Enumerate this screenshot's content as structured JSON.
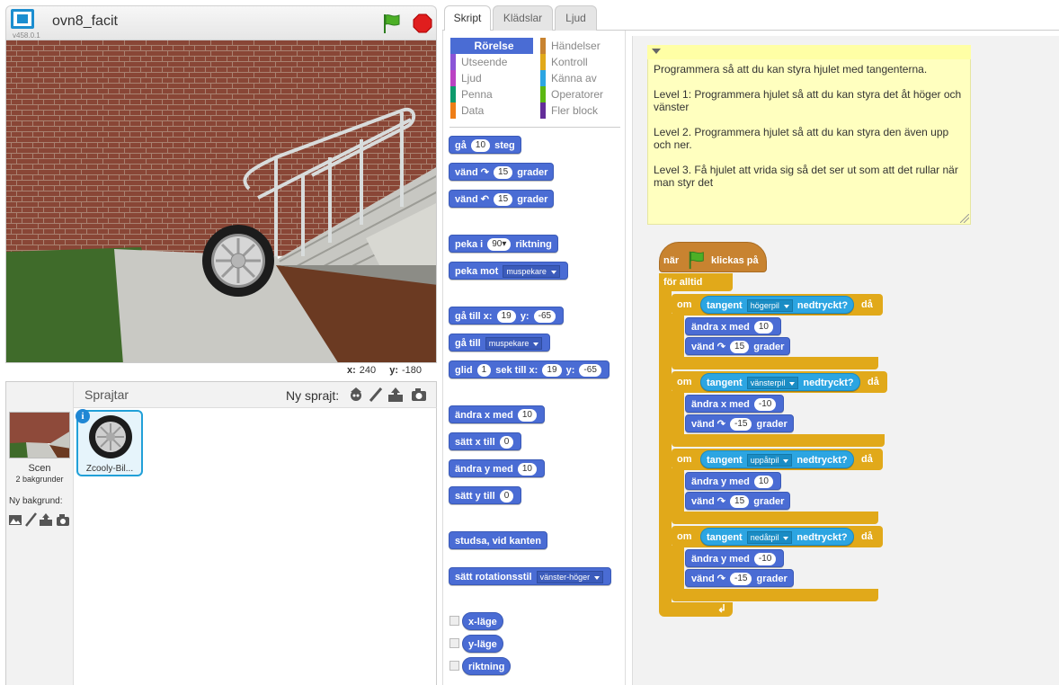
{
  "stage": {
    "title": "ovn8_facit",
    "version": "v458.0.1",
    "x_label": "x:",
    "x_value": "240",
    "y_label": "y:",
    "y_value": "-180"
  },
  "sprites": {
    "title": "Sprajtar",
    "new_sprite": "Ny sprajt:",
    "scene_label": "Scen",
    "scene_backdrops": "2 bakgrunder",
    "new_backdrop": "Ny bakgrund:",
    "sprite_name": "Zcooly-Bil..."
  },
  "tabs": [
    "Skript",
    "Klädslar",
    "Ljud"
  ],
  "categories": {
    "left": [
      "Rörelse",
      "Utseende",
      "Ljud",
      "Penna",
      "Data"
    ],
    "right": [
      "Händelser",
      "Kontroll",
      "Känna av",
      "Operatorer",
      "Fler block"
    ],
    "colors_left": [
      "#4a6cd4",
      "#8a55d7",
      "#bb42c3",
      "#0e9a6c",
      "#ee7d16"
    ],
    "colors_right": [
      "#c88330",
      "#e1a91a",
      "#2ca5e2",
      "#5cb712",
      "#632d99"
    ]
  },
  "palette": {
    "move": [
      "gå",
      "10",
      "steg"
    ],
    "turn_right": [
      "vänd",
      "15",
      "grader"
    ],
    "turn_left": [
      "vänd",
      "15",
      "grader"
    ],
    "point_dir": [
      "peka i",
      "90▾",
      "riktning"
    ],
    "point_towards": [
      "peka mot",
      "muspekare"
    ],
    "goto_xy": [
      "gå till x:",
      "19",
      "y:",
      "-65"
    ],
    "goto": [
      "gå till",
      "muspekare"
    ],
    "glide": [
      "glid",
      "1",
      "sek till x:",
      "19",
      "y:",
      "-65"
    ],
    "change_x": [
      "ändra x med",
      "10"
    ],
    "set_x": [
      "sätt x till",
      "0"
    ],
    "change_y": [
      "ändra y med",
      "10"
    ],
    "set_y": [
      "sätt y till",
      "0"
    ],
    "bounce": "studsa, vid kanten",
    "rotation_style": [
      "sätt rotationsstil",
      "vänster-höger"
    ],
    "reporters": [
      "x-läge",
      "y-läge",
      "riktning"
    ]
  },
  "comment": [
    "Programmera så att du kan styra hjulet med tangenterna.",
    "Level 1: Programmera hjulet så att du kan styra det åt höger och vänster",
    "Level 2. Programmera hjulet så att du kan styra den även upp och ner.",
    "Level 3. Få hjulet att vrida sig så det ser ut som att det rullar när man styr det"
  ],
  "script": {
    "hat_when": "när",
    "hat_clicked": "klickas på",
    "forever": "för alltid",
    "if": "om",
    "then": "då",
    "key": "tangent",
    "pressed": "nedtryckt?",
    "change_x": "ändra x med",
    "change_y": "ändra y med",
    "turn": "vänd",
    "degrees": "grader",
    "ifs": [
      {
        "key": "högerpil",
        "change": "x",
        "amount": "10",
        "turn": "15"
      },
      {
        "key": "vänsterpil",
        "change": "x",
        "amount": "-10",
        "turn": "-15"
      },
      {
        "key": "uppåtpil",
        "change": "y",
        "amount": "10",
        "turn": "15"
      },
      {
        "key": "nedåtpil",
        "change": "y",
        "amount": "-10",
        "turn": "-15"
      }
    ]
  }
}
